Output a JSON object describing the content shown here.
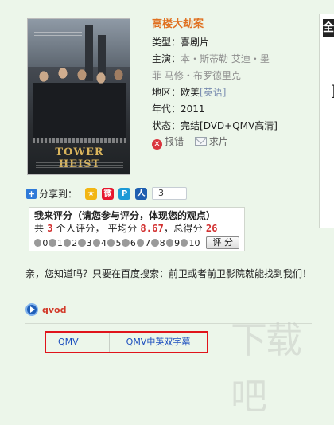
{
  "movie": {
    "title": "高楼大劫案",
    "type_label": "类型：",
    "type_value": "喜剧片",
    "cast_label": "主演：",
    "cast_line1": "本・斯蒂勒   艾迪・墨",
    "cast_line2": "菲   马修・布罗德里克",
    "region_label": "地区：",
    "region_value": "欧美",
    "region_lang": "[英语]",
    "year_label": "年代：",
    "year_value": "2011",
    "status_label": "状态：",
    "status_value": "完结[DVD+QMV高清]",
    "report_label": "报错",
    "request_label": "求片",
    "poster_title": "TOWER HEIST"
  },
  "right_panel": {
    "tab_char": "全",
    "big_char": "I"
  },
  "share": {
    "label": "分享到：",
    "count": "3",
    "services": [
      "qzone-icon",
      "weibo-icon",
      "tencent-weibo-icon",
      "renren-icon"
    ]
  },
  "rating": {
    "title": "我来评分（请您参与评分，体现您的观点）",
    "prefix": "共",
    "count": "3",
    "mid1": "个人评分，  平均分",
    "average": "8.67",
    "mid2": "，总得分",
    "total": "26",
    "scale": [
      "0",
      "1",
      "2",
      "3",
      "4",
      "5",
      "6",
      "7",
      "8",
      "9",
      "10"
    ],
    "button_label": "评 分"
  },
  "tip": "亲，您知道吗？只要在百度搜索：前卫或者前卫影院就能找到我们！",
  "player": {
    "name": "qvod"
  },
  "play_links": [
    "QMV",
    "QMV中英双字幕"
  ],
  "watermark": "下载吧"
}
